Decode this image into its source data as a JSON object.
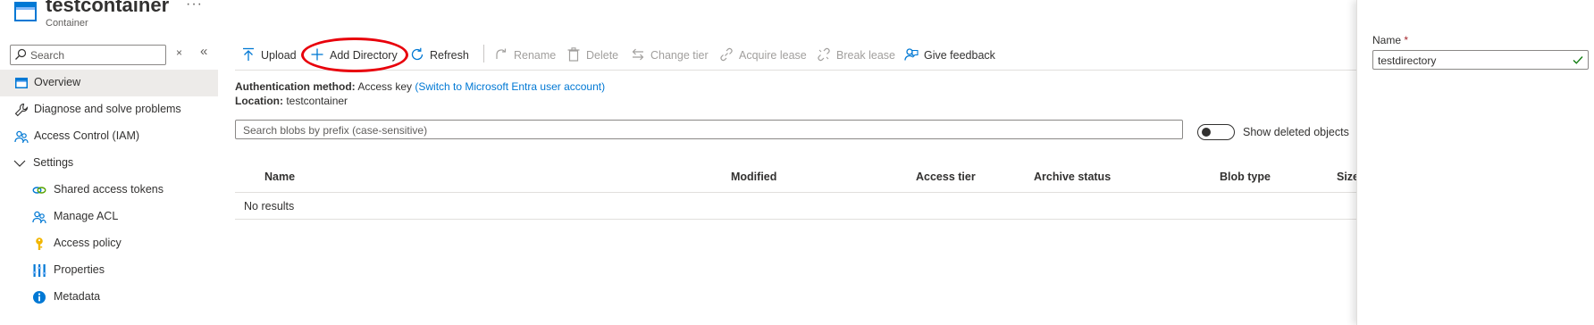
{
  "header": {
    "title": "testcontainer",
    "subtitle": "Container",
    "more_label": "···"
  },
  "sidebar": {
    "search_placeholder": "Search",
    "clear_label": "×",
    "collapse_label": "«",
    "items": [
      {
        "label": "Overview",
        "icon": "overview-icon",
        "active": true
      },
      {
        "label": "Diagnose and solve problems",
        "icon": "wrench-icon"
      },
      {
        "label": "Access Control (IAM)",
        "icon": "people-icon"
      },
      {
        "label": "Settings",
        "icon": "chevron-down-icon"
      },
      {
        "label": "Shared access tokens",
        "icon": "link-icon"
      },
      {
        "label": "Manage ACL",
        "icon": "people-icon"
      },
      {
        "label": "Access policy",
        "icon": "key-icon"
      },
      {
        "label": "Properties",
        "icon": "properties-icon"
      },
      {
        "label": "Metadata",
        "icon": "info-icon"
      }
    ]
  },
  "toolbar": {
    "upload": "Upload",
    "add_directory": "Add Directory",
    "refresh": "Refresh",
    "rename": "Rename",
    "delete": "Delete",
    "change_tier": "Change tier",
    "acquire_lease": "Acquire lease",
    "break_lease": "Break lease",
    "give_feedback": "Give feedback"
  },
  "info": {
    "auth_label": "Authentication method:",
    "auth_value": "Access key",
    "auth_link": "(Switch to Microsoft Entra user account)",
    "location_label": "Location:",
    "location_value": "testcontainer"
  },
  "blob_search": {
    "placeholder": "Search blobs by prefix (case-sensitive)"
  },
  "show_deleted": {
    "label": "Show deleted objects",
    "on": false
  },
  "table": {
    "columns": [
      "Name",
      "Modified",
      "Access tier",
      "Archive status",
      "Blob type",
      "Size"
    ],
    "empty_text": "No results"
  },
  "panel": {
    "name_label": "Name",
    "required_mark": "*",
    "name_value": "testdirectory"
  },
  "colors": {
    "accent": "#0078d4",
    "highlight": "#e8000b",
    "valid": "#107c10"
  }
}
